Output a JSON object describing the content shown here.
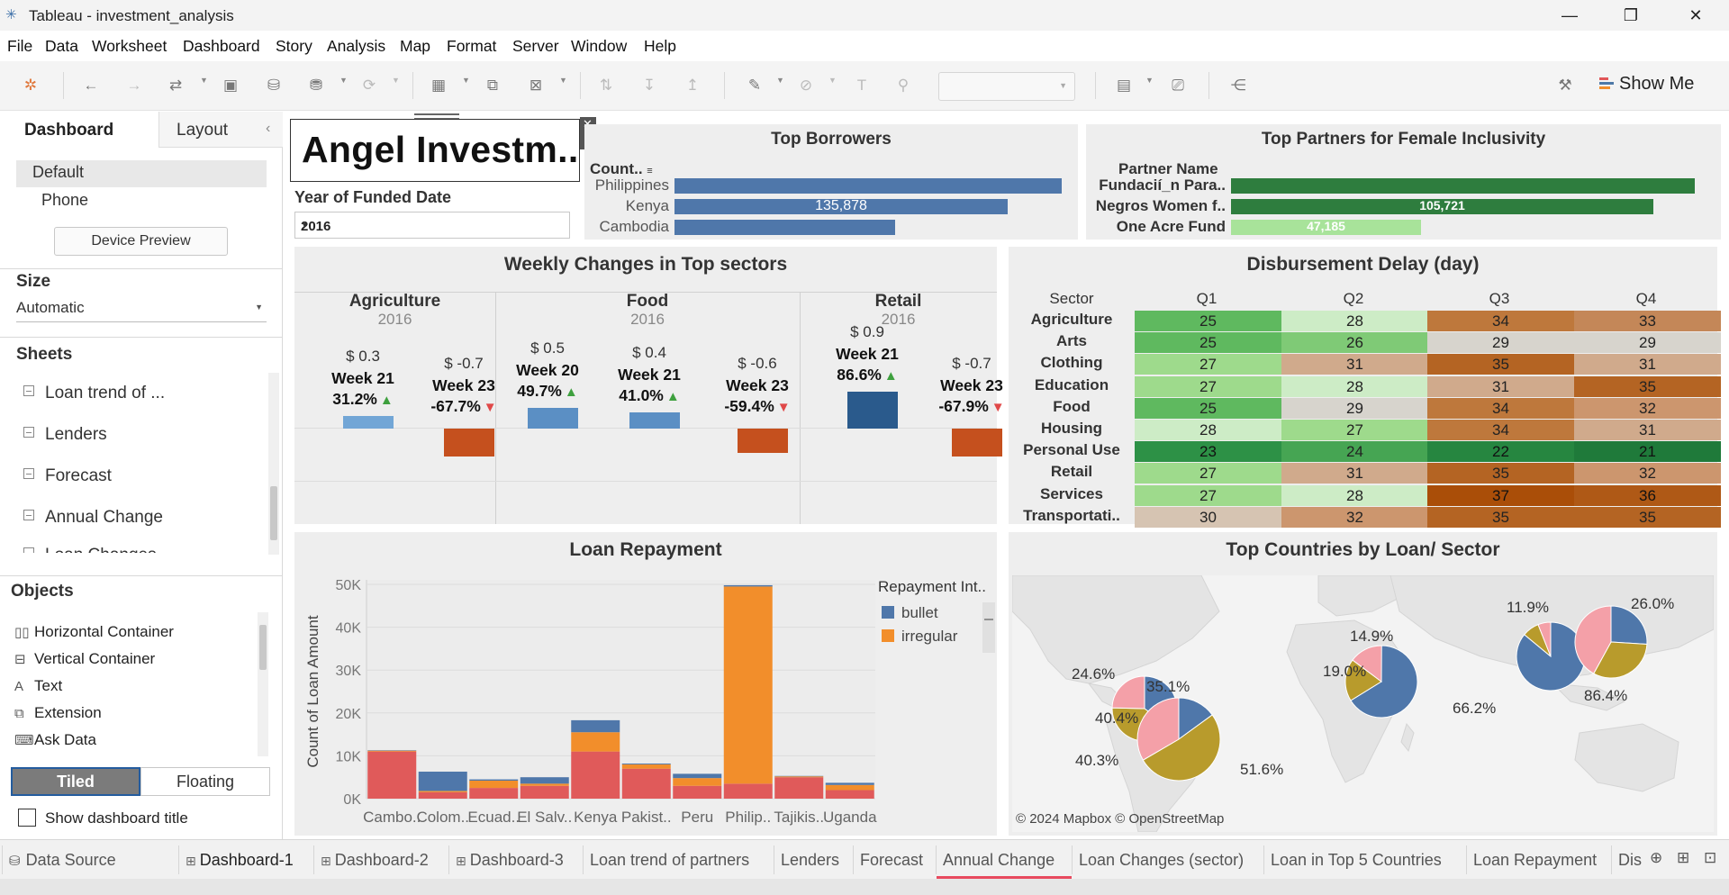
{
  "window": {
    "title": "Tableau - investment_analysis",
    "minimize": "—",
    "restore": "❐",
    "close": "✕"
  },
  "menu": [
    "File",
    "Data",
    "Worksheet",
    "Dashboard",
    "Story",
    "Analysis",
    "Map",
    "Format",
    "Server",
    "Window",
    "Help"
  ],
  "toolbar": {
    "show_me": "Show Me"
  },
  "left_panel": {
    "tabs": {
      "dashboard": "Dashboard",
      "layout": "Layout",
      "collapse": "‹"
    },
    "devices": [
      "Default",
      "Phone"
    ],
    "device_preview": "Device Preview",
    "size_label": "Size",
    "size_value": "Automatic",
    "sheets_label": "Sheets",
    "sheets": [
      "Loan trend of ...",
      "Lenders",
      "Forecast",
      "Annual Change",
      "Loan Changes"
    ],
    "objects_label": "Objects",
    "objects": [
      {
        "icon": "horizontal-container-icon",
        "glyph": "▯▯",
        "label": "Horizontal Container"
      },
      {
        "icon": "vertical-container-icon",
        "glyph": "⊟",
        "label": "Vertical Container"
      },
      {
        "icon": "text-icon",
        "glyph": "A",
        "label": "Text"
      },
      {
        "icon": "extension-icon",
        "glyph": "⧉",
        "label": "Extension"
      },
      {
        "icon": "ask-data-icon",
        "glyph": "⌨",
        "label": "Ask Data"
      }
    ],
    "tiled": "Tiled",
    "floating": "Floating",
    "show_title": "Show dashboard title"
  },
  "dashboard": {
    "title_text": "Angel Investm..",
    "year_filter_label": "Year of Funded Date",
    "year_filter_value": "2016",
    "top_borrowers": {
      "title": "Top Borrowers",
      "axis_header": "Count..",
      "rows": [
        {
          "label": "Philippines",
          "fraction": 1.0,
          "value_label": ""
        },
        {
          "label": "Kenya",
          "fraction": 0.86,
          "value_label": "135,878"
        },
        {
          "label": "Cambodia",
          "fraction": 0.57,
          "value_label": ""
        }
      ],
      "color": "#4f77aa"
    },
    "top_partners": {
      "title": "Top Partners for Female Inclusivity",
      "axis_header": "Partner Name",
      "rows": [
        {
          "label": "Fundacií_n Para..",
          "fraction": 1.0,
          "value_label": "",
          "color": "#2e7d3e"
        },
        {
          "label": "Negros Women f..",
          "fraction": 0.91,
          "value_label": "105,721",
          "color": "#2e7d3e"
        },
        {
          "label": "One Acre Fund",
          "fraction": 0.41,
          "value_label": "47,185",
          "color": "#a8e39a"
        }
      ]
    },
    "weekly": {
      "title": "Weekly  Changes in Top sectors",
      "sectors": [
        {
          "name": "Agriculture",
          "year": "2016",
          "items": [
            {
              "price": "$ 0.3",
              "week": "Week 21",
              "pct": "31.2%",
              "dir": "up",
              "value": 0.3
            },
            {
              "price": "$ -0.7",
              "week": "Week 23",
              "pct": "-67.7%",
              "dir": "down",
              "value": -0.7
            }
          ]
        },
        {
          "name": "Food",
          "year": "2016",
          "items": [
            {
              "price": "$ 0.5",
              "week": "Week 20",
              "pct": "49.7%",
              "dir": "up",
              "value": 0.5
            },
            {
              "price": "$ 0.4",
              "week": "Week 21",
              "pct": "41.0%",
              "dir": "up",
              "value": 0.4
            },
            {
              "price": "$ -0.6",
              "week": "Week 23",
              "pct": "-59.4%",
              "dir": "down",
              "value": -0.6
            }
          ]
        },
        {
          "name": "Retail",
          "year": "2016",
          "items": [
            {
              "price": "$ 0.9",
              "week": "Week 21",
              "pct": "86.6%",
              "dir": "up",
              "value": 0.9
            },
            {
              "price": "$ -0.7",
              "week": "Week 23",
              "pct": "-67.9%",
              "dir": "down",
              "value": -0.7
            }
          ]
        }
      ]
    },
    "disbursement": {
      "title": "Disbursement Delay (day)",
      "row_header": "Sector",
      "columns": [
        "Q1",
        "Q2",
        "Q3",
        "Q4"
      ],
      "rows": [
        {
          "sector": "Agriculture",
          "values": [
            25,
            28,
            34,
            33
          ]
        },
        {
          "sector": "Arts",
          "values": [
            25,
            26,
            29,
            29
          ]
        },
        {
          "sector": "Clothing",
          "values": [
            27,
            31,
            35,
            31
          ]
        },
        {
          "sector": "Education",
          "values": [
            27,
            28,
            31,
            35
          ]
        },
        {
          "sector": "Food",
          "values": [
            25,
            29,
            34,
            32
          ]
        },
        {
          "sector": "Housing",
          "values": [
            28,
            27,
            34,
            31
          ]
        },
        {
          "sector": "Personal Use",
          "values": [
            23,
            24,
            22,
            21
          ]
        },
        {
          "sector": "Retail",
          "values": [
            27,
            31,
            35,
            32
          ]
        },
        {
          "sector": "Services",
          "values": [
            27,
            28,
            37,
            36
          ]
        },
        {
          "sector": "Transportati..",
          "values": [
            30,
            32,
            35,
            35
          ]
        }
      ]
    },
    "map": {
      "title": "Top Countries by Loan/ Sector",
      "attribution": "© 2024 Mapbox © OpenStreetMap",
      "pie_labels": [
        "24.6%",
        "35.1%",
        "40.4%",
        "40.3%",
        "51.6%",
        "14.9%",
        "19.0%",
        "66.2%",
        "11.9%",
        "26.0%",
        "86.4%"
      ]
    }
  },
  "chart_data": {
    "type": "bar",
    "title": "Loan Repayment",
    "xlabel": "",
    "ylabel": "Count of Loan Amount",
    "ylim": [
      0,
      50000
    ],
    "y_ticks": [
      "0K",
      "10K",
      "20K",
      "30K",
      "40K",
      "50K"
    ],
    "categories": [
      "Cambo..",
      "Colom..",
      "Ecuad..",
      "El Salv..",
      "Kenya",
      "Pakist..",
      "Peru",
      "Philip..",
      "Tajikis..",
      "Uganda"
    ],
    "legend_title": "Repayment Int..",
    "legend_placement": "top-right",
    "stacked": true,
    "series": [
      {
        "name": "",
        "color": "#e05a5a",
        "values": [
          11000,
          1500,
          2500,
          3000,
          11000,
          7000,
          3000,
          3500,
          5000,
          2000
        ]
      },
      {
        "name": "irregular",
        "color": "#f28e2b",
        "values": [
          200,
          300,
          1700,
          500,
          4500,
          1000,
          1800,
          46000,
          200,
          1200
        ]
      },
      {
        "name": "bullet",
        "color": "#4f77aa",
        "values": [
          100,
          4500,
          300,
          1500,
          2800,
          200,
          1000,
          300,
          100,
          500
        ]
      }
    ]
  },
  "bottom_tabs": [
    "Data Source",
    "Dashboard-1",
    "Dashboard-2",
    "Dashboard-3",
    "Loan trend of partners",
    "Lenders",
    "Forecast",
    "Annual Change",
    "Loan Changes (sector)",
    "Loan in Top 5 Countries",
    "Loan Repayment",
    "Dis"
  ],
  "colors": {
    "accent_underline": "#e84a5f",
    "heat_low": "#1f7a3a",
    "heat_high": "#b35806"
  }
}
